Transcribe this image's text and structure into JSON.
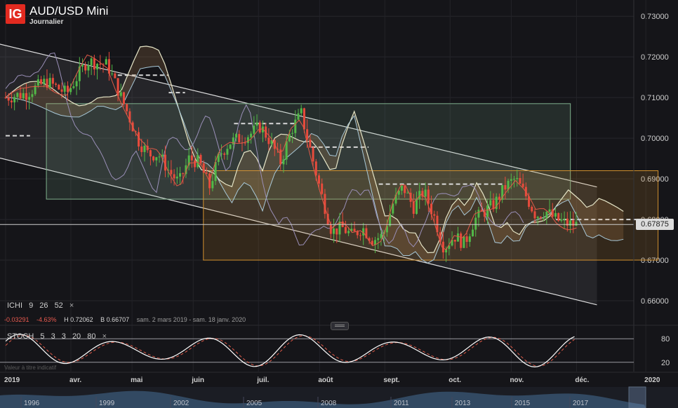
{
  "header": {
    "logo_text": "IG",
    "title": "AUD/USD Mini",
    "subtitle": "Journalier"
  },
  "ichimoku": {
    "name": "ICHI",
    "p1": "9",
    "p2": "26",
    "p3": "52",
    "close_glyph": "×"
  },
  "stats": {
    "change": "-0.03291",
    "change_pct": "-4.63%",
    "high": "H 0.72062",
    "low": "B 0.66707",
    "period": "sam. 2 mars 2019 - sam. 18 janv. 2020"
  },
  "stochastic": {
    "name": "STOCH",
    "p1": "5",
    "p2": "3",
    "p3": "3",
    "p4": "20",
    "p5": "80",
    "close_glyph": "×",
    "level_high": "80",
    "level_low": "20"
  },
  "note": "Valeur à titre indicatif",
  "current_price": "0.67875",
  "colors": {
    "background": "#151519",
    "up": "#52b848",
    "down": "#e84b3c",
    "channel": "#ffffff",
    "green_box": "#7fb08c",
    "orange_box": "#d1902e",
    "price_tag": "#dcdcdc"
  },
  "chart_data": {
    "type": "candlestick",
    "title": "AUD/USD Mini",
    "ylim": [
      0.655,
      0.734
    ],
    "y_ticks": [
      "0.73000",
      "0.72000",
      "0.71000",
      "0.70000",
      "0.69000",
      "0.68000",
      "0.67000",
      "0.66000"
    ],
    "y_tick_values": [
      0.73,
      0.72,
      0.71,
      0.7,
      0.69,
      0.68,
      0.67,
      0.66
    ],
    "x_labels": [
      "2019",
      "avr.",
      "mai",
      "juin",
      "juil.",
      "août",
      "sept.",
      "oct.",
      "nov.",
      "déc.",
      "2020"
    ],
    "x_label_days": [
      0,
      32,
      62,
      92,
      124,
      154,
      186,
      218,
      248,
      280,
      314
    ],
    "overview_labels": [
      "1996",
      "1999",
      "2002",
      "2005",
      "2008",
      "2011",
      "2013",
      "2015",
      "2017"
    ],
    "last_price": 0.67875,
    "high": 0.72062,
    "low": 0.66707,
    "close_series_day": [
      0,
      10,
      20,
      30,
      40,
      50,
      55,
      60,
      65,
      70,
      75,
      80,
      85,
      90,
      95,
      100,
      105,
      110,
      115,
      120,
      125,
      130,
      135,
      140,
      145,
      150,
      155,
      160,
      165,
      170,
      175,
      180,
      185,
      190,
      195,
      200,
      205,
      210,
      215,
      220,
      225,
      230,
      235,
      240,
      245,
      250,
      255,
      260,
      265,
      270,
      275,
      280
    ],
    "close_series": [
      0.71,
      0.711,
      0.714,
      0.711,
      0.719,
      0.718,
      0.712,
      0.706,
      0.6995,
      0.696,
      0.696,
      0.692,
      0.689,
      0.695,
      0.694,
      0.688,
      0.696,
      0.699,
      0.7,
      0.701,
      0.703,
      0.699,
      0.694,
      0.702,
      0.706,
      0.696,
      0.686,
      0.677,
      0.678,
      0.676,
      0.678,
      0.675,
      0.676,
      0.684,
      0.688,
      0.683,
      0.687,
      0.681,
      0.673,
      0.676,
      0.674,
      0.68,
      0.682,
      0.684,
      0.688,
      0.69,
      0.686,
      0.681,
      0.682,
      0.68,
      0.679,
      0.6787
    ],
    "stoch_levels": [
      80,
      20
    ],
    "channel_upper": [
      [
        -10,
        0.724
      ],
      [
        290,
        0.688
      ]
    ],
    "channel_lower": [
      [
        -10,
        0.696
      ],
      [
        290,
        0.659
      ]
    ],
    "green_box": {
      "x0_day": 20,
      "x1_day": 277,
      "y_top": 0.7085,
      "y_bottom": 0.685
    },
    "orange_box": {
      "x0_day": 97,
      "x1_day": 320,
      "y_top": 0.692,
      "y_bottom": 0.67
    },
    "dashed_levels": [
      {
        "x0_day": 0,
        "x1_day": 12,
        "y": 0.7006
      },
      {
        "x0_day": 55,
        "x1_day": 80,
        "y": 0.7155
      },
      {
        "x0_day": 80,
        "x1_day": 88,
        "y": 0.7112
      },
      {
        "x0_day": 112,
        "x1_day": 142,
        "y": 0.7036
      },
      {
        "x0_day": 150,
        "x1_day": 178,
        "y": 0.6978
      },
      {
        "x0_day": 183,
        "x1_day": 245,
        "y": 0.6887
      },
      {
        "x0_day": 270,
        "x1_day": 312,
        "y": 0.68
      }
    ]
  }
}
